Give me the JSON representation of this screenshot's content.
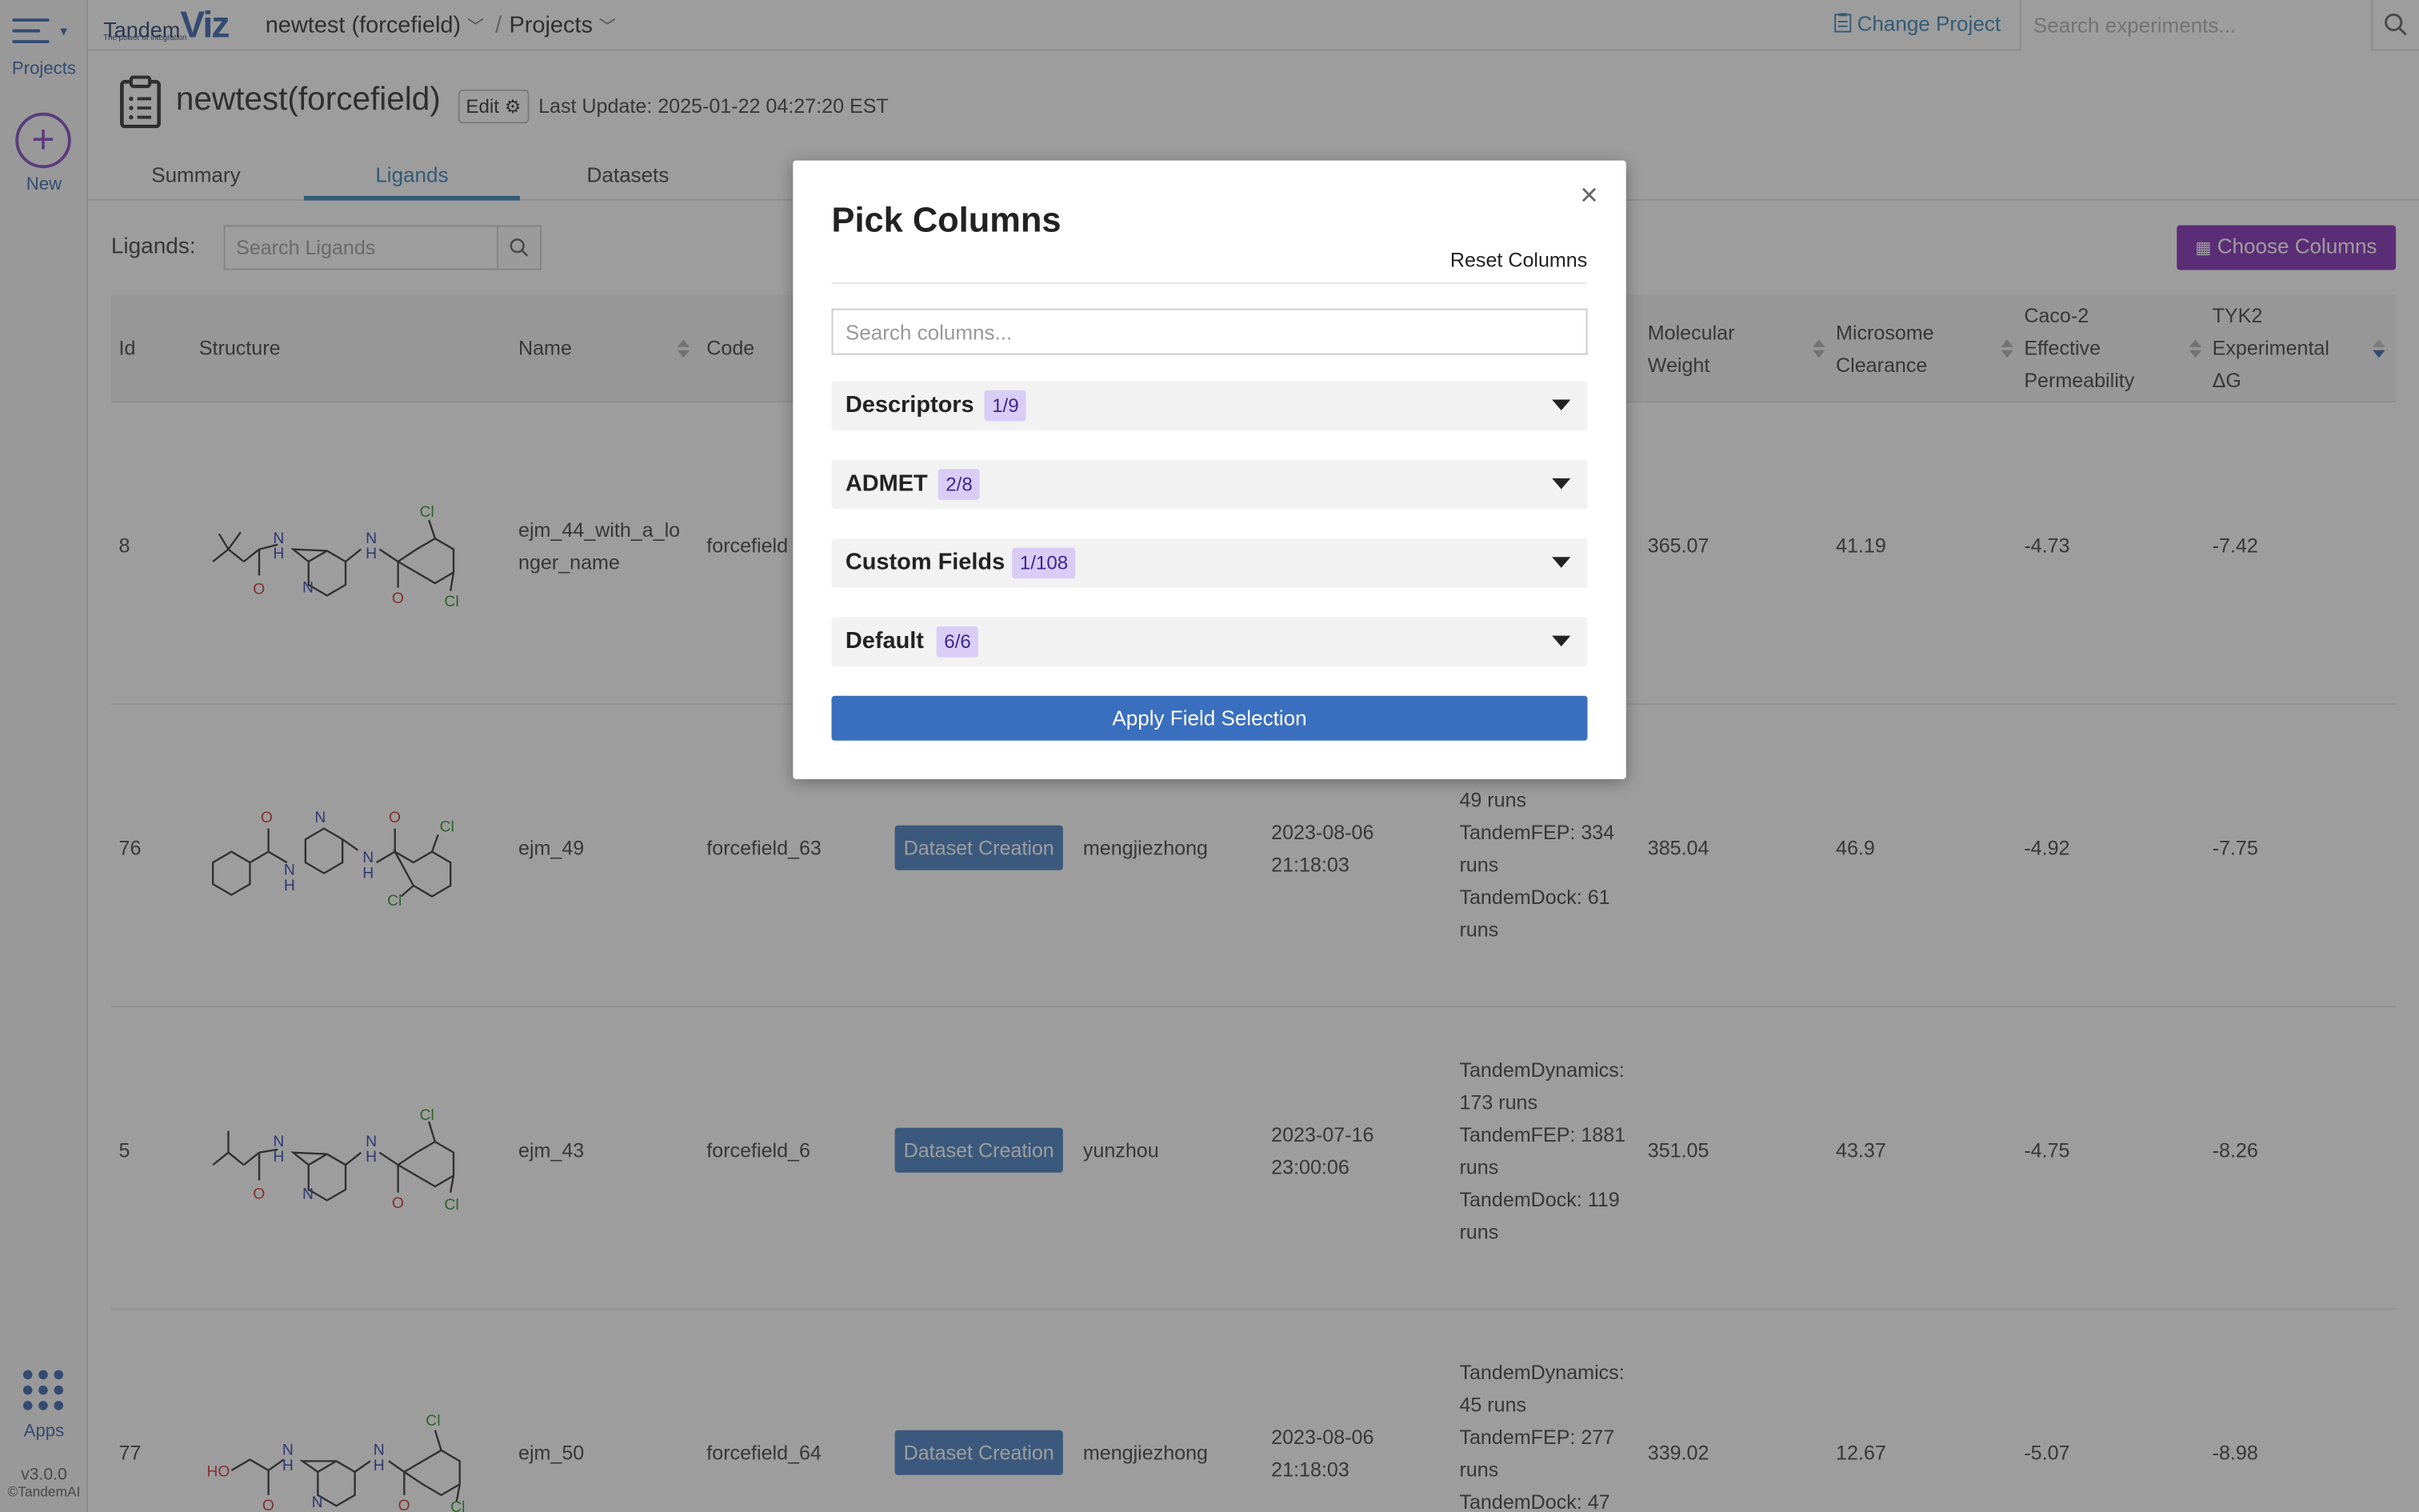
{
  "rail": {
    "projects_label": "Projects",
    "new_label": "New",
    "apps_label": "Apps",
    "version": "v3.0.0",
    "copyright": "©TandemAI"
  },
  "topbar": {
    "logo_text": "Tandem",
    "logo_accent": "Viz",
    "logo_tagline": "The power of integration",
    "breadcrumb_project": "newtest (forcefield)",
    "breadcrumb_sep": "/",
    "breadcrumb_projects": "Projects",
    "change_project": "Change Project",
    "search_placeholder": "Search experiments..."
  },
  "header": {
    "title": "newtest(forcefield)",
    "edit_label": "Edit",
    "last_update": "Last Update: 2025-01-22 04:27:20 EST"
  },
  "tabs": [
    "Summary",
    "Ligands",
    "Datasets"
  ],
  "ligands": {
    "label": "Ligands:",
    "search_placeholder": "Search Ligands",
    "choose_columns": "Choose Columns"
  },
  "table": {
    "headers": {
      "id": "Id",
      "structure": "Structure",
      "name": "Name",
      "code": "Code",
      "mw": "Molecular Weight",
      "micro": "Microsome Clearance",
      "caco": "Caco-2 Effective Permeability",
      "tyk2": "TYK2 Experimental ΔG"
    },
    "rows": [
      {
        "id": "8",
        "name": "ejm_44_with_a_longer_name",
        "code": "forcefield",
        "badge": "",
        "user": "",
        "date": "",
        "runs": [],
        "mw": "365.07",
        "micro": "41.19",
        "caco": "-4.73",
        "tyk2": "-7.42"
      },
      {
        "id": "76",
        "name": "ejm_49",
        "code": "forcefield_63",
        "badge": "Dataset Creation",
        "user": "mengjiezhong",
        "date": "2023-08-06 21:18:03",
        "runs": [
          "49 runs",
          "TandemFEP: 334",
          "runs",
          "TandemDock: 61",
          "runs"
        ],
        "mw": "385.04",
        "micro": "46.9",
        "caco": "-4.92",
        "tyk2": "-7.75"
      },
      {
        "id": "5",
        "name": "ejm_43",
        "code": "forcefield_6",
        "badge": "Dataset Creation",
        "user": "yunzhou",
        "date": "2023-07-16 23:00:06",
        "runs": [
          "TandemDynamics:",
          "173 runs",
          "TandemFEP: 1881",
          "runs",
          "TandemDock: 119",
          "runs"
        ],
        "mw": "351.05",
        "micro": "43.37",
        "caco": "-4.75",
        "tyk2": "-8.26"
      },
      {
        "id": "77",
        "name": "ejm_50",
        "code": "forcefield_64",
        "badge": "Dataset Creation",
        "user": "mengjiezhong",
        "date": "2023-08-06 21:18:03",
        "runs": [
          "TandemDynamics:",
          "45 runs",
          "TandemFEP: 277",
          "runs",
          "TandemDock: 47"
        ],
        "mw": "339.02",
        "micro": "12.67",
        "caco": "-5.07",
        "tyk2": "-8.98"
      }
    ]
  },
  "modal": {
    "title": "Pick Columns",
    "close": "×",
    "reset": "Reset Columns",
    "search_placeholder": "Search columns...",
    "groups": [
      {
        "name": "Descriptors",
        "count": "1/9"
      },
      {
        "name": "ADMET",
        "count": "2/8"
      },
      {
        "name": "Custom Fields",
        "count": "1/108"
      },
      {
        "name": "Default",
        "count": "6/6"
      }
    ],
    "apply": "Apply Field Selection"
  },
  "colors": {
    "accent_blue": "#2b7ab0",
    "purple": "#7a1fb0",
    "badge_blue": "#3a77bf",
    "count_bg": "#d9cdf6"
  }
}
